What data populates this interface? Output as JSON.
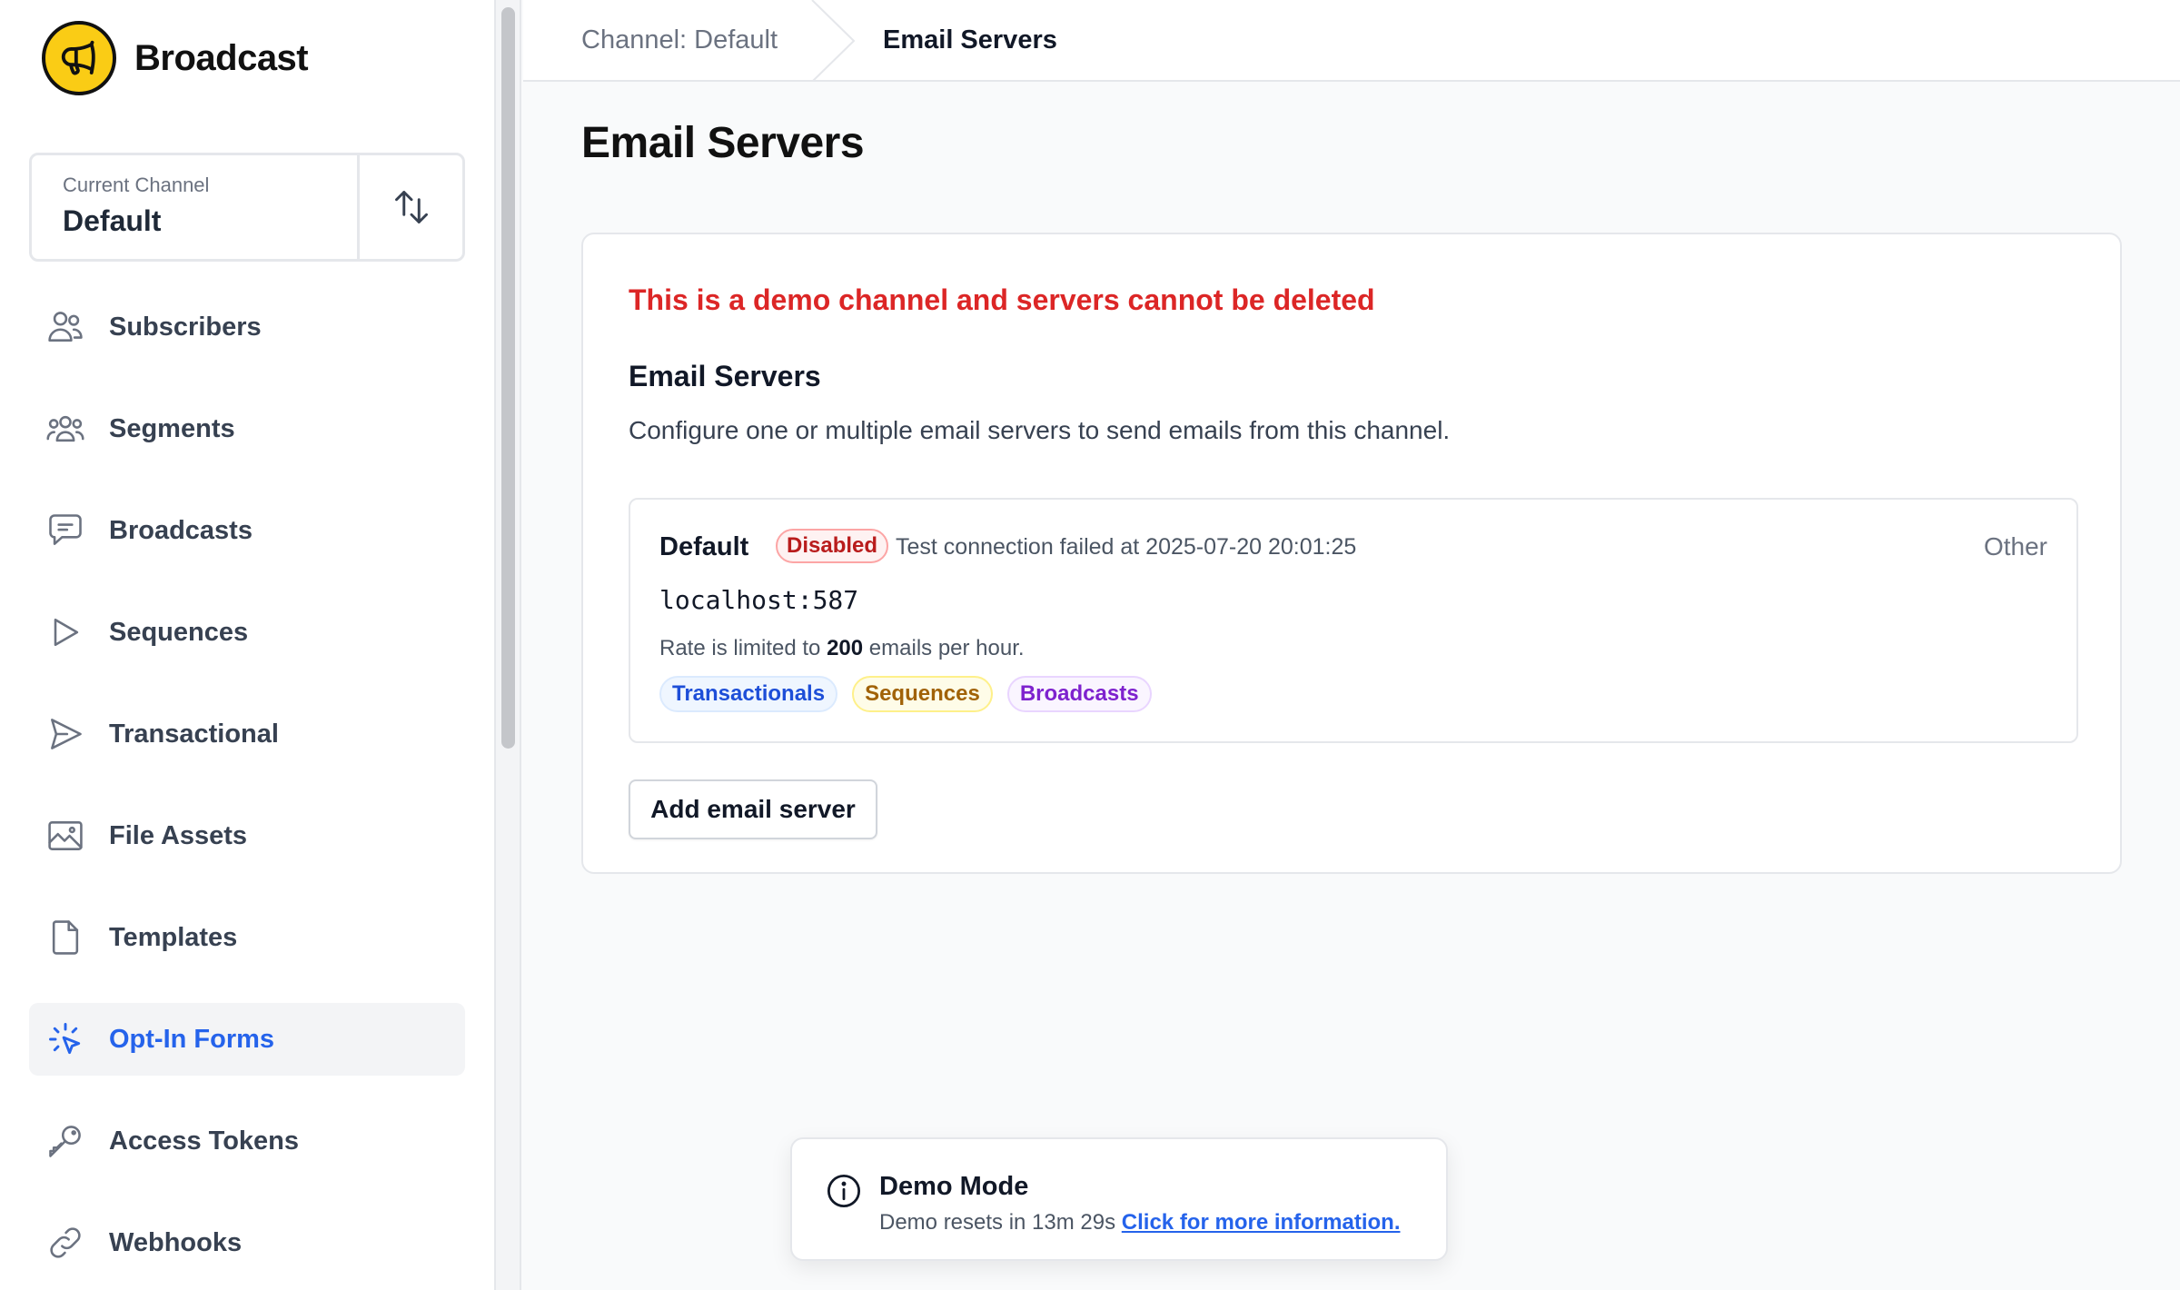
{
  "brand": {
    "name": "Broadcast",
    "logo_icon": "megaphone-icon",
    "logo_color": "#facc15"
  },
  "channel_selector": {
    "label": "Current Channel",
    "value": "Default",
    "switch_icon": "arrows-up-down-icon"
  },
  "sidebar": {
    "items": [
      {
        "label": "Subscribers",
        "icon": "users-icon"
      },
      {
        "label": "Segments",
        "icon": "user-group-icon"
      },
      {
        "label": "Broadcasts",
        "icon": "chat-bubble-icon"
      },
      {
        "label": "Sequences",
        "icon": "play-icon"
      },
      {
        "label": "Transactional",
        "icon": "paper-airplane-icon"
      },
      {
        "label": "File Assets",
        "icon": "photo-icon"
      },
      {
        "label": "Templates",
        "icon": "document-icon"
      },
      {
        "label": "Opt-In Forms",
        "icon": "cursor-click-icon",
        "active": true
      },
      {
        "label": "Access Tokens",
        "icon": "key-icon"
      },
      {
        "label": "Webhooks",
        "icon": "link-icon"
      }
    ],
    "active_color": "#2563eb"
  },
  "breadcrumb": {
    "parent": "Channel: Default",
    "current": "Email Servers"
  },
  "page": {
    "title": "Email Servers"
  },
  "card": {
    "warning": "This is a demo channel and servers cannot be deleted",
    "section_title": "Email Servers",
    "section_description": "Configure one or multiple email servers to send emails from this channel.",
    "add_button_label": "Add email server"
  },
  "server": {
    "name": "Default",
    "status_badge": "Disabled",
    "status_text": "Test connection failed at 2025-07-20 20:01:25",
    "type": "Other",
    "host": "localhost:587",
    "rate_prefix": "Rate is limited to",
    "rate_value": "200",
    "rate_suffix": "emails per hour.",
    "tags": [
      "Transactionals",
      "Sequences",
      "Broadcasts"
    ]
  },
  "toast": {
    "icon": "info-circle-icon",
    "title": "Demo Mode",
    "body": "Demo resets in 13m 29s",
    "link": "Click for more information."
  }
}
